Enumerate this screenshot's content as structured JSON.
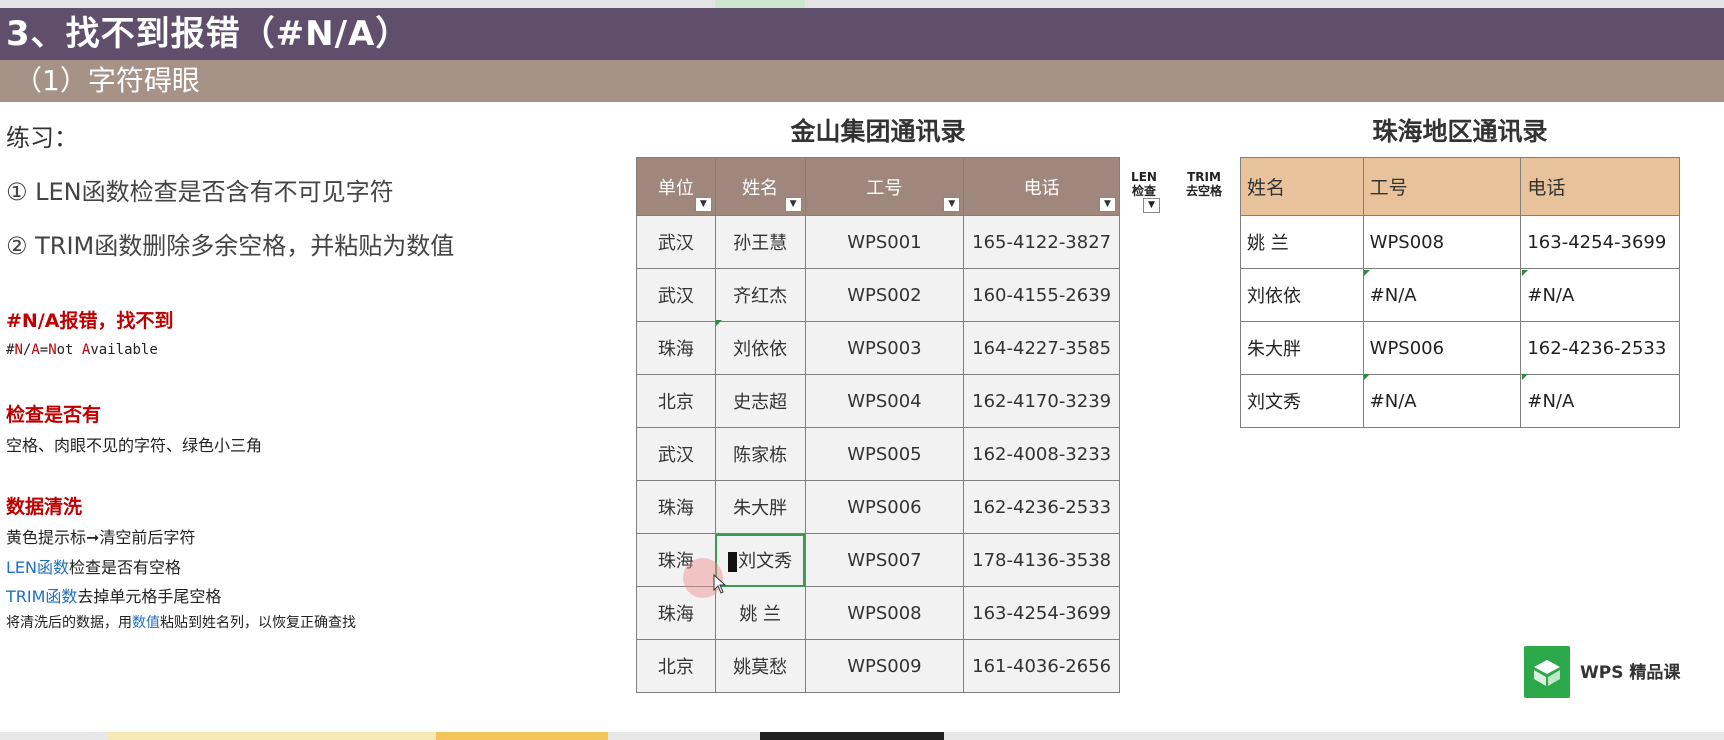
{
  "header": {
    "title": "3、找不到报错（#N/A）",
    "subtitle": "（1）字符碍眼"
  },
  "left": {
    "practice_label": "练习：",
    "exercise1": "① LEN函数检查是否含有不可见字符",
    "exercise2": "② TRIM函数删除多余空格，并粘贴为数值",
    "na_title": "#N/A报错，找不到",
    "na_line": {
      "p1": "#",
      "p2": "N",
      "p3": "/",
      "p4": "A",
      "p5": "=",
      "p6": "N",
      "p7": "ot ",
      "p8": "A",
      "p9": "vailable"
    },
    "check_title": "检查是否有",
    "check_line": "空格、肉眼不见的字符、绿色小三角",
    "clean_title": "数据清洗",
    "clean_line1": "黄色提示标➞清空前后字符",
    "clean_line2_a": "LEN函数",
    "clean_line2_b": "检查是否有空格",
    "clean_line3_a": "TRIM函数",
    "clean_line3_b": "去掉单元格手尾空格",
    "clean_line4_a": "将清洗后的数据，用",
    "clean_line4_b": "数值",
    "clean_line4_c": "粘贴到姓名列，以恢复正确查找"
  },
  "main_table": {
    "title": "金山集团通讯录",
    "headers": [
      "单位",
      "姓名",
      "工号",
      "电话"
    ],
    "rows": [
      [
        "武汉",
        "孙王慧",
        "WPS001",
        "165-4122-3827"
      ],
      [
        "武汉",
        "齐红杰",
        "WPS002",
        "160-4155-2639"
      ],
      [
        "珠海",
        "刘依依",
        "WPS003",
        "164-4227-3585"
      ],
      [
        "北京",
        "史志超",
        "WPS004",
        "162-4170-3239"
      ],
      [
        "武汉",
        "陈家栋",
        "WPS005",
        "162-4008-3233"
      ],
      [
        "珠海",
        "朱大胖",
        "WPS006",
        "162-4236-2533"
      ],
      [
        "珠海",
        "刘文秀",
        "WPS007",
        "178-4136-3538"
      ],
      [
        "珠海",
        "姚 兰",
        "WPS008",
        "163-4254-3699"
      ],
      [
        "北京",
        "姚莫愁",
        "WPS009",
        "161-4036-2656"
      ]
    ]
  },
  "helper_columns": {
    "len_top": "LEN",
    "len_bottom": "检查",
    "trim_top": "TRIM",
    "trim_bottom": "去空格"
  },
  "zhuhai_table": {
    "title": "珠海地区通讯录",
    "headers": [
      "姓名",
      "工号",
      "电话"
    ],
    "rows": [
      [
        "姚 兰",
        "WPS008",
        "163-4254-3699"
      ],
      [
        "刘依依",
        "#N/A",
        "#N/A"
      ],
      [
        "朱大胖",
        "WPS006",
        "162-4236-2533"
      ],
      [
        "刘文秀",
        "#N/A",
        "#N/A"
      ]
    ]
  },
  "logo": {
    "text": "WPS 精品课"
  },
  "colors": {
    "title_bar": "#5f4f6c",
    "sub_bar": "#a79287",
    "main_header": "#a0877d",
    "zhuhai_header": "#e8c29a",
    "accent_red": "#c00000",
    "accent_blue": "#1f6fc5",
    "logo_green": "#2aa84a"
  }
}
